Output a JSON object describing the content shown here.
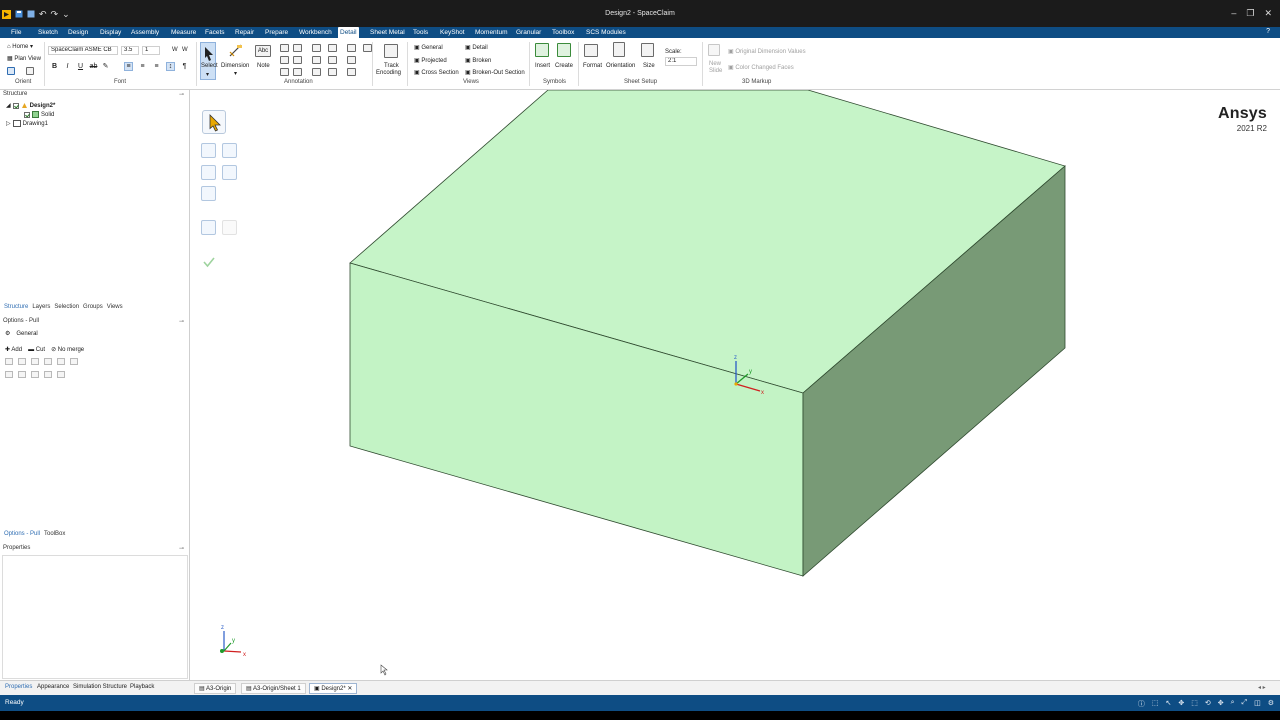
{
  "window": {
    "title": "Design2 - SpaceClaim",
    "min": "–",
    "max": "❐",
    "close": "✕"
  },
  "qat": {
    "undo": "↶",
    "redo": "↷",
    "more": "⌄"
  },
  "menus": [
    "File",
    "Sketch",
    "Design",
    "Display",
    "Assembly",
    "Measure",
    "Facets",
    "Repair",
    "Prepare",
    "Workbench",
    "Detail",
    "Sheet Metal",
    "Tools",
    "KeyShot",
    "Momentum",
    "Granular",
    "Toolbox",
    "SCS Modules"
  ],
  "active_menu": "Detail",
  "ribbon": {
    "orient": {
      "home": "Home",
      "plan_view": "Plan View",
      "label": "Orient"
    },
    "font": {
      "family": "SpaceClaim ASME CB",
      "size": "3.5",
      "scale": "1",
      "label": "Font"
    },
    "select": {
      "label": "Select"
    },
    "dimension": {
      "label": "Dimension"
    },
    "note": {
      "label": "Note",
      "glyph": "Abc"
    },
    "annotation": {
      "label": "Annotation"
    },
    "track": {
      "line1": "Track",
      "line2": "Encoding"
    },
    "views": {
      "general": "General",
      "projected": "Projected",
      "cross_section": "Cross Section",
      "detail": "Detail",
      "broken": "Broken",
      "broken_out": "Broken-Out Section",
      "label": "Views"
    },
    "symbols": {
      "insert": "Insert",
      "create": "Create",
      "label": "Symbols"
    },
    "sheet_setup": {
      "format": "Format",
      "orientation": "Orientation",
      "size": "Size",
      "scale_label": "Scale:",
      "scale_value": "2:1",
      "label": "Sheet Setup"
    },
    "markup": {
      "new_slide": "New Slide",
      "orig_dim": "Original Dimension Values",
      "color_changed": "Color Changed Faces",
      "label": "3D Markup"
    }
  },
  "structure": {
    "title": "Structure",
    "tree": [
      {
        "label": "Design2*",
        "level": 0
      },
      {
        "label": "Solid",
        "level": 1
      },
      {
        "label": "Drawing1",
        "level": 0
      }
    ],
    "tabs": [
      "Structure",
      "Layers",
      "Selection",
      "Groups",
      "Views"
    ]
  },
  "options": {
    "title": "Options - Pull",
    "general": "General",
    "add": "Add",
    "cut": "Cut",
    "no_merge": "No merge",
    "tabs": [
      "Options - Pull",
      "ToolBox"
    ]
  },
  "properties": {
    "title": "Properties"
  },
  "bottom_tabs": [
    "Properties",
    "Appearance",
    "Simulation Structure",
    "Playback"
  ],
  "doc_tabs": [
    "A3-Origin",
    "A3-Origin/Sheet 1",
    "Design2*"
  ],
  "status": "Ready",
  "brand": {
    "name": "Ansys",
    "version": "2021 R2"
  },
  "axes": {
    "x": "x",
    "y": "y",
    "z": "z"
  },
  "colors": {
    "menubar": "#0e4d84",
    "box_top": "#c6f4c8",
    "box_front": "#c3f3c5",
    "box_side": "#789a76"
  }
}
